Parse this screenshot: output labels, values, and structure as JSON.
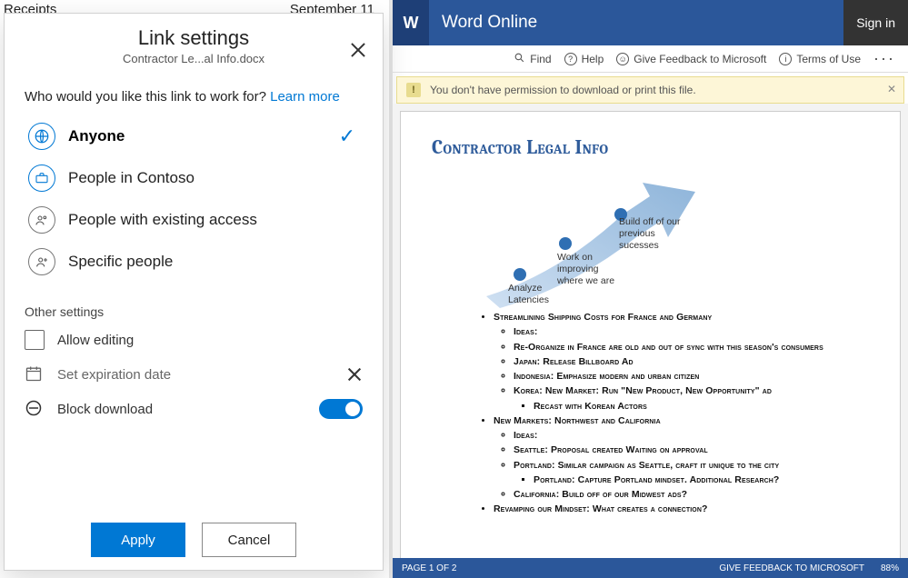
{
  "peek": {
    "left": "Receipts",
    "right": "September 11"
  },
  "dialog": {
    "title": "Link settings",
    "subtitle": "Contractor Le...al Info.docx",
    "prompt_pre": "Who would you like this link to work for? ",
    "prompt_link": "Learn more",
    "options": [
      {
        "label": "Anyone",
        "selected": true
      },
      {
        "label": "People in Contoso",
        "selected": false
      },
      {
        "label": "People with existing access",
        "selected": false
      },
      {
        "label": "Specific people",
        "selected": false
      }
    ],
    "other_label": "Other settings",
    "allow_editing": "Allow editing",
    "expiration": "Set expiration date",
    "block_download": "Block download",
    "apply": "Apply",
    "cancel": "Cancel"
  },
  "word": {
    "logo": "W",
    "app": "Word Online",
    "signin": "Sign in",
    "toolbar": {
      "find": "Find",
      "help": "Help",
      "feedback": "Give Feedback to Microsoft",
      "terms": "Terms of Use"
    },
    "banner": "You don't have permission to download or print this file.",
    "doc_title": "Contractor Legal Info",
    "captions": {
      "c1": "Analyze Latencies",
      "c2": "Work on improving where we are",
      "c3": "Build off of our previous sucesses"
    },
    "bullets": {
      "b1": "Streamlining Shipping Costs for France and Germany",
      "b1a": "Ideas:",
      "b1b": "Re-Organize in France are old and out of sync with this season's consumers",
      "b1c": "Japan: Release  Billboard Ad",
      "b1d": "Indonesia: Emphasize modern and urban citizen",
      "b1e": "Korea: New Market:  Run \"New Product, New Opportunity\" ad",
      "b1e1": "Recast with Korean Actors",
      "b2": "New Markets: Northwest and California",
      "b2a": "Ideas:",
      "b2b": "Seattle: Proposal created Waiting on approval",
      "b2c": "Portland: Similar campaign as Seattle, craft it unique to the city",
      "b2c1": "Portland: Capture Portland mindset.  Additional Research?",
      "b2d": "California:  Build off of our Midwest ads?",
      "b3": "Revamping our Mindset:  What creates a connection?"
    },
    "status": {
      "page": "PAGE 1 OF 2",
      "feedback": "GIVE FEEDBACK TO MICROSOFT",
      "zoom": "88%"
    }
  }
}
